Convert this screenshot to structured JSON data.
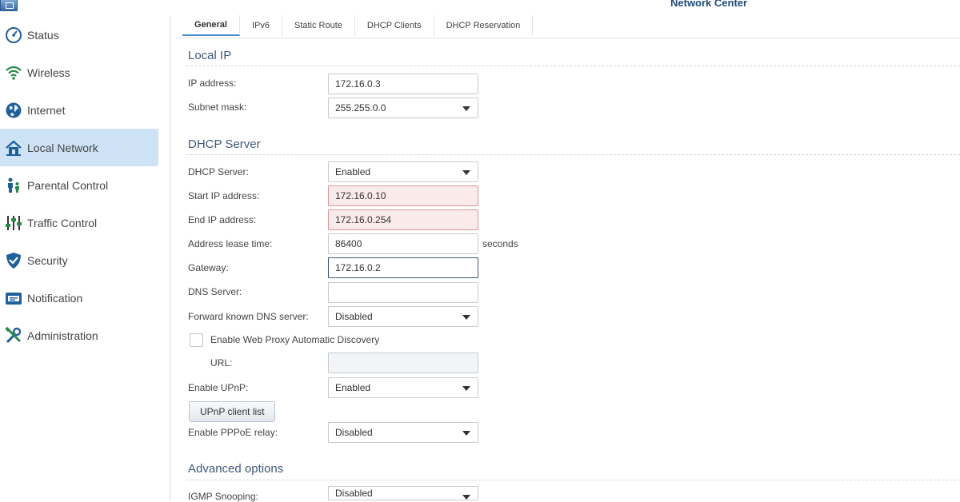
{
  "window": {
    "title": "Network Center"
  },
  "sidebar": {
    "items": [
      {
        "label": "Status",
        "icon": "gauge-icon",
        "active": false
      },
      {
        "label": "Wireless",
        "icon": "wifi-icon",
        "active": false
      },
      {
        "label": "Internet",
        "icon": "globe-icon",
        "active": false
      },
      {
        "label": "Local Network",
        "icon": "home-icon",
        "active": true
      },
      {
        "label": "Parental Control",
        "icon": "family-icon",
        "active": false
      },
      {
        "label": "Traffic Control",
        "icon": "sliders-icon",
        "active": false
      },
      {
        "label": "Security",
        "icon": "shield-icon",
        "active": false
      },
      {
        "label": "Notification",
        "icon": "envelope-icon",
        "active": false
      },
      {
        "label": "Administration",
        "icon": "tools-icon",
        "active": false
      }
    ]
  },
  "tabs": [
    {
      "label": "General",
      "active": true
    },
    {
      "label": "IPv6",
      "active": false
    },
    {
      "label": "Static Route",
      "active": false
    },
    {
      "label": "DHCP Clients",
      "active": false
    },
    {
      "label": "DHCP Reservation",
      "active": false
    }
  ],
  "local_ip": {
    "title": "Local IP",
    "ip_address": {
      "label": "IP address:",
      "value": "172.16.0.3"
    },
    "subnet_mask": {
      "label": "Subnet mask:",
      "value": "255.255.0.0"
    }
  },
  "dhcp": {
    "title": "DHCP Server",
    "server": {
      "label": "DHCP Server:",
      "value": "Enabled"
    },
    "start_ip": {
      "label": "Start IP address:",
      "value": "172.16.0.10"
    },
    "end_ip": {
      "label": "End IP address:",
      "value": "172.16.0.254"
    },
    "lease": {
      "label": "Address lease time:",
      "value": "86400",
      "unit": "seconds"
    },
    "gateway": {
      "label": "Gateway:",
      "value": "172.16.0.2"
    },
    "dns": {
      "label": "DNS Server:",
      "value": ""
    },
    "forward_dns": {
      "label": "Forward known DNS server:",
      "value": "Disabled"
    },
    "wpad": {
      "label": "Enable Web Proxy Automatic Discovery",
      "checked": false
    },
    "url": {
      "label": "URL:",
      "value": ""
    },
    "upnp": {
      "label": "Enable UPnP:",
      "value": "Enabled"
    },
    "upnp_button": "UPnP client list",
    "pppoe": {
      "label": "Enable PPPoE relay:",
      "value": "Disabled"
    }
  },
  "advanced": {
    "title": "Advanced options",
    "igmp": {
      "label": "IGMP Snooping:",
      "value": "Disabled"
    }
  },
  "colors": {
    "accent": "#4a8bd0",
    "sidebar_active": "#cde3f5",
    "error_bg": "#fbeaea",
    "error_border": "#d99898",
    "icon_blue": "#1f5f9c",
    "icon_green": "#2a8a4a"
  }
}
